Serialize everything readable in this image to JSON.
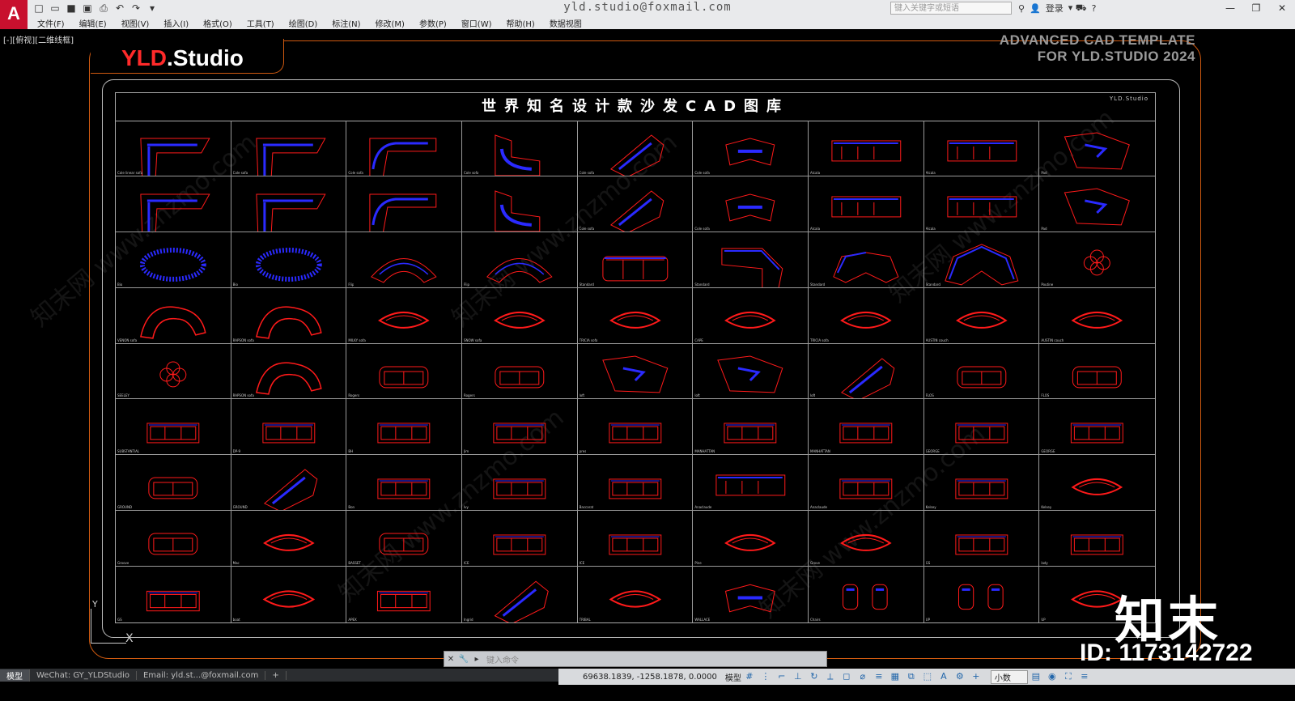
{
  "window": {
    "title": "yld.studio@foxmail.com",
    "app_logo": "A",
    "search_placeholder": "键入关键字或短语",
    "login_label": "登录"
  },
  "menubar": {
    "items": [
      "文件(F)",
      "编辑(E)",
      "视图(V)",
      "插入(I)",
      "格式(O)",
      "工具(T)",
      "绘图(D)",
      "标注(N)",
      "修改(M)",
      "参数(P)",
      "窗口(W)",
      "帮助(H)",
      "数据视图"
    ]
  },
  "viewport": {
    "view_label": "[-][俯视][二维线框]"
  },
  "drawing": {
    "brand_prefix": "YLD",
    "brand_suffix": ".Studio",
    "cad_title_line1": "ADVANCED  CAD  TEMPLATE",
    "cad_title_line2": "FOR YLD.STUDIO 2024",
    "sheet_title": "世界知名设计款沙发CAD图库",
    "sheet_tag": "YLD.Studio",
    "ucs_y": "Y",
    "ucs_x": "X"
  },
  "cells": [
    {
      "shape": "L",
      "label": "Cole linear sofa"
    },
    {
      "shape": "L",
      "label": "Cole sofa"
    },
    {
      "shape": "L2",
      "label": "Cole sofa"
    },
    {
      "shape": "U",
      "label": "Cole sofa"
    },
    {
      "shape": "diag",
      "label": "Cole sofa"
    },
    {
      "shape": "wing",
      "label": "Cole sofa"
    },
    {
      "shape": "long",
      "label": "Alcala"
    },
    {
      "shape": "long",
      "label": "Alcala"
    },
    {
      "shape": "poly",
      "label": "Pad"
    },
    {
      "shape": "L",
      "label": ""
    },
    {
      "shape": "L",
      "label": ""
    },
    {
      "shape": "L2",
      "label": ""
    },
    {
      "shape": "U",
      "label": ""
    },
    {
      "shape": "diag",
      "label": "Cole sofa"
    },
    {
      "shape": "wing",
      "label": "Cole sofa"
    },
    {
      "shape": "long",
      "label": "Alcala"
    },
    {
      "shape": "long",
      "label": "Alcala"
    },
    {
      "shape": "poly",
      "label": "Pad"
    },
    {
      "shape": "blob",
      "label": "Bio"
    },
    {
      "shape": "blob",
      "label": "Bio"
    },
    {
      "shape": "arc",
      "label": "Flip"
    },
    {
      "shape": "arc",
      "label": "Flip"
    },
    {
      "shape": "sec",
      "label": "Standard"
    },
    {
      "shape": "corner",
      "label": "Standard"
    },
    {
      "shape": "arc2",
      "label": "Standard"
    },
    {
      "shape": "big",
      "label": "Standard"
    },
    {
      "shape": "round",
      "label": "Poutine"
    },
    {
      "shape": "curve",
      "label": "VENON sofa"
    },
    {
      "shape": "curve",
      "label": "RAPSON sofa"
    },
    {
      "shape": "ring",
      "label": "MILKY sofa"
    },
    {
      "shape": "ring",
      "label": "SNOW sofa"
    },
    {
      "shape": "ring",
      "label": "TRICIA sofa"
    },
    {
      "shape": "ring",
      "label": "CAPE"
    },
    {
      "shape": "ring",
      "label": "TRICIA sofa"
    },
    {
      "shape": "ring",
      "label": "AUSTIN couch"
    },
    {
      "shape": "ring",
      "label": "AUSTIN couch"
    },
    {
      "shape": "round",
      "label": "SEELEY"
    },
    {
      "shape": "curve",
      "label": "RAPSON sofa"
    },
    {
      "shape": "sofa",
      "label": "Rogers"
    },
    {
      "shape": "sofa",
      "label": "Rogers"
    },
    {
      "shape": "poly",
      "label": "loft"
    },
    {
      "shape": "poly",
      "label": "loft"
    },
    {
      "shape": "diag",
      "label": "loft"
    },
    {
      "shape": "sofa",
      "label": "FLOS"
    },
    {
      "shape": "sofa",
      "label": "FLOS"
    },
    {
      "shape": "rect",
      "label": "SUBSTANTIAL"
    },
    {
      "shape": "rect",
      "label": "DP-9"
    },
    {
      "shape": "rect",
      "label": "BH"
    },
    {
      "shape": "rect",
      "label": "Jim"
    },
    {
      "shape": "rect",
      "label": "pres"
    },
    {
      "shape": "rect",
      "label": "MANHATTAN"
    },
    {
      "shape": "rect",
      "label": "MANHATTAN"
    },
    {
      "shape": "rect",
      "label": "GEORGE"
    },
    {
      "shape": "rect",
      "label": "GEORGE"
    },
    {
      "shape": "sofa",
      "label": "GROUND"
    },
    {
      "shape": "diag",
      "label": "GROUND"
    },
    {
      "shape": "rect",
      "label": "Bon"
    },
    {
      "shape": "rect",
      "label": "Ivy"
    },
    {
      "shape": "rect",
      "label": "Baccarat"
    },
    {
      "shape": "long",
      "label": "Anaclaude"
    },
    {
      "shape": "rect",
      "label": "Anaclaude"
    },
    {
      "shape": "rect",
      "label": "Kelsey"
    },
    {
      "shape": "ring",
      "label": "Kelsey"
    },
    {
      "shape": "sofa",
      "label": "Groove"
    },
    {
      "shape": "ring",
      "label": "Mac"
    },
    {
      "shape": "sofa",
      "label": "BASSET"
    },
    {
      "shape": "rect",
      "label": "ICE"
    },
    {
      "shape": "rect",
      "label": "ICE"
    },
    {
      "shape": "ring",
      "label": "Pine"
    },
    {
      "shape": "ring",
      "label": "Grove"
    },
    {
      "shape": "rect",
      "label": "GS"
    },
    {
      "shape": "rect",
      "label": "lady"
    },
    {
      "shape": "rect",
      "label": "GS"
    },
    {
      "shape": "ring",
      "label": "boat"
    },
    {
      "shape": "rect",
      "label": "APEX"
    },
    {
      "shape": "diag",
      "label": "Ingrid"
    },
    {
      "shape": "ring",
      "label": "TRIBAL"
    },
    {
      "shape": "wing",
      "label": "WALLACE"
    },
    {
      "shape": "chairs",
      "label": "Chairs"
    },
    {
      "shape": "chairs",
      "label": "UP"
    },
    {
      "shape": "ring",
      "label": "UP"
    }
  ],
  "command": {
    "placeholder": "键入命令"
  },
  "layout_tabs": {
    "items": [
      "模型",
      "WeChat:  GY_YLDStudio",
      "Email:  yld.st...@foxmail.com",
      "+"
    ]
  },
  "status": {
    "coords": "69638.1839, -1258.1878, 0.0000",
    "mode": "模型",
    "units": "小数"
  },
  "watermark": {
    "logo": "知末",
    "id": "ID: 1173142722",
    "text": "知末网 www.znzmo.com"
  },
  "colors": {
    "accent_orange": "#d05a10",
    "brand_red": "#ff2a2a",
    "shape_red": "#ff1a1a",
    "shape_blue": "#2a2aff"
  }
}
